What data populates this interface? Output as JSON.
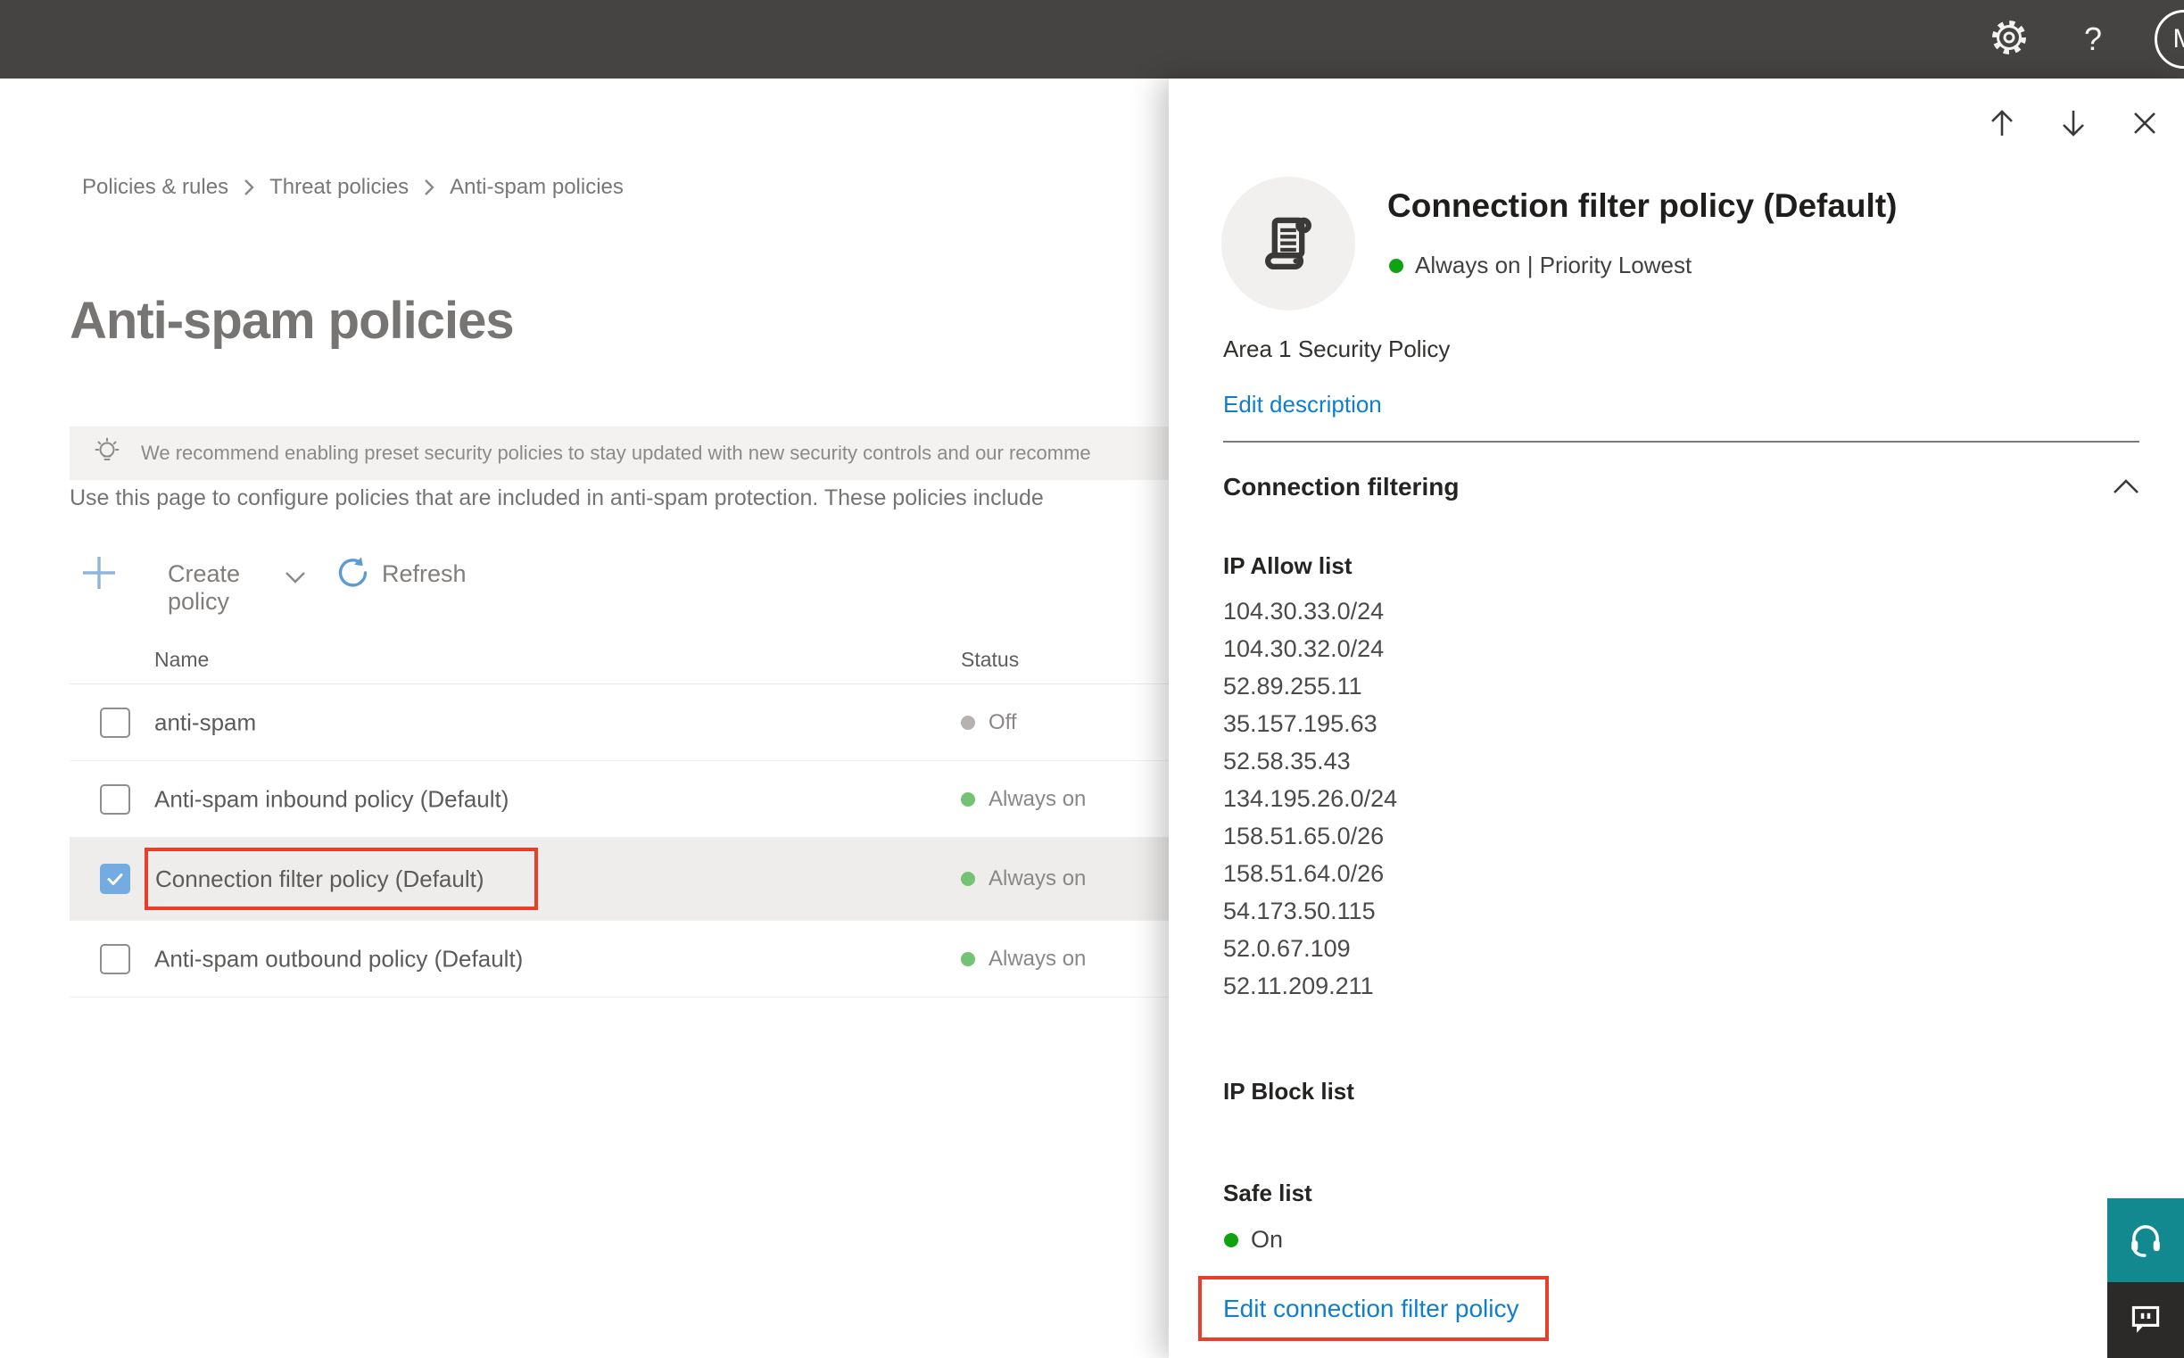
{
  "topbar": {
    "help_glyph": "?",
    "avatar_initial": "M"
  },
  "breadcrumb": {
    "items": [
      "Policies & rules",
      "Threat policies",
      "Anti-spam policies"
    ]
  },
  "page": {
    "title": "Anti-spam policies",
    "banner_text": "We recommend enabling preset security policies to stay updated with new security controls and our recomme",
    "intro_text": "Use this page to configure policies that are included in anti-spam protection. These policies include",
    "toolbar": {
      "create_policy_label": "Create policy",
      "refresh_label": "Refresh"
    }
  },
  "table": {
    "columns": [
      "Name",
      "Status"
    ],
    "rows": [
      {
        "name": "anti-spam",
        "status": "Off",
        "status_color": "gray",
        "checked": false,
        "selected": false
      },
      {
        "name": "Anti-spam inbound policy (Default)",
        "status": "Always on",
        "status_color": "green",
        "checked": false,
        "selected": false
      },
      {
        "name": "Connection filter policy (Default)",
        "status": "Always on",
        "status_color": "green",
        "checked": true,
        "selected": true,
        "highlighted_with_red_outline": true
      },
      {
        "name": "Anti-spam outbound policy (Default)",
        "status": "Always on",
        "status_color": "green",
        "checked": false,
        "selected": false
      }
    ]
  },
  "panel": {
    "title": "Connection filter policy (Default)",
    "status_line": "Always on | Priority Lowest",
    "description": "Area 1 Security Policy",
    "edit_description_label": "Edit description",
    "section_title": "Connection filtering",
    "ip_allow": {
      "label": "IP Allow list",
      "items": [
        "104.30.33.0/24",
        "104.30.32.0/24",
        "52.89.255.11",
        "35.157.195.63",
        "52.58.35.43",
        "134.195.26.0/24",
        "158.51.65.0/26",
        "158.51.64.0/26",
        "54.173.50.115",
        "52.0.67.109",
        "52.11.209.211"
      ]
    },
    "ip_block": {
      "label": "IP Block list"
    },
    "safe_list": {
      "label": "Safe list",
      "value": "On"
    },
    "edit_link_label": "Edit connection filter policy"
  },
  "colors": {
    "topbar": "#464442",
    "link_blue": "#0f7ecb",
    "status_green_table": "#74c374",
    "status_green_panel": "#10a310",
    "status_gray": "#b5b2af",
    "red_outline": "#e6402a",
    "checkbox_blue": "#74abe0",
    "help_teal": "#12888f",
    "feedback_dark": "#2b2a29"
  }
}
